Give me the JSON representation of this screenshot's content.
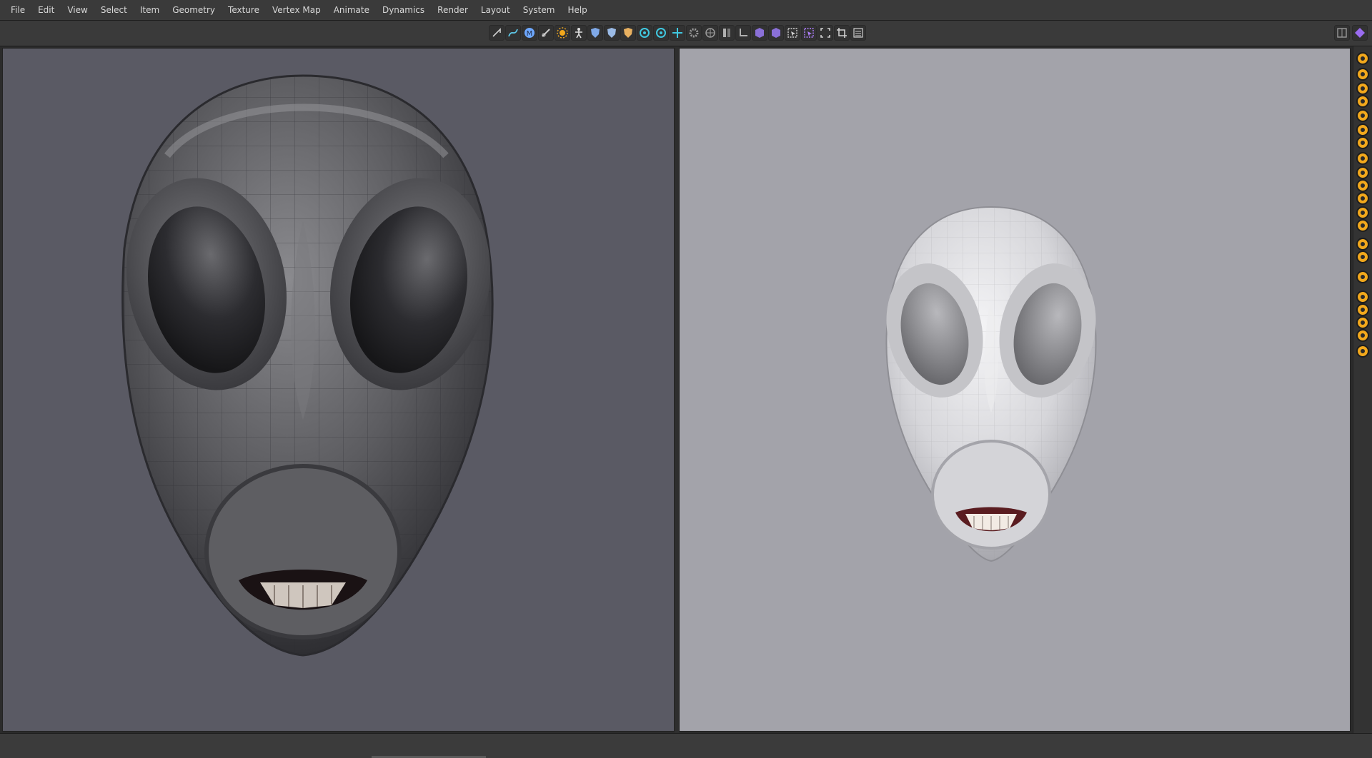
{
  "menu": [
    "File",
    "Edit",
    "View",
    "Select",
    "Item",
    "Geometry",
    "Texture",
    "Vertex Map",
    "Animate",
    "Dynamics",
    "Render",
    "Layout",
    "System",
    "Help"
  ],
  "toolbar": {
    "tools": [
      {
        "name": "pen-icon",
        "color": "#cfcfcf"
      },
      {
        "name": "curve-icon",
        "color": "#5ec8e8"
      },
      {
        "name": "m-tool-icon",
        "color": "#6ea8ff"
      },
      {
        "name": "link-icon",
        "color": "#cfcfcf"
      },
      {
        "name": "sun-icon",
        "color": "#f2a81c"
      },
      {
        "name": "figure-icon",
        "color": "#e0e0e0"
      },
      {
        "name": "shield-blue-icon",
        "color": "#7fa9e8"
      },
      {
        "name": "shield-light-icon",
        "color": "#9bbbe6"
      },
      {
        "name": "shield-orange-icon",
        "color": "#e8b060"
      },
      {
        "name": "target-icon",
        "color": "#40c8e0"
      },
      {
        "name": "ring-icon",
        "color": "#40c8e0"
      },
      {
        "name": "crosshair-icon",
        "color": "#40c8e0"
      },
      {
        "name": "gear-icon",
        "color": "#9a9a9a"
      },
      {
        "name": "grid-icon",
        "color": "#9a9a9a"
      },
      {
        "name": "split-icon",
        "color": "#b0b0b0"
      },
      {
        "name": "corner-icon",
        "color": "#b0b0b0"
      },
      {
        "name": "cube-purple-icon",
        "color": "#8a70d8"
      },
      {
        "name": "cube-dark-icon",
        "color": "#8a70d8"
      },
      {
        "name": "select-icon",
        "color": "#d0d0d0"
      },
      {
        "name": "select-purple-icon",
        "color": "#b080ff"
      },
      {
        "name": "frame-icon",
        "color": "#d0d0d0"
      },
      {
        "name": "crop-icon",
        "color": "#d0d0d0"
      },
      {
        "name": "list-icon",
        "color": "#d0d0d0"
      }
    ],
    "right": [
      {
        "name": "layout-icon",
        "color": "#9a9a9a"
      },
      {
        "name": "purple-gem-icon",
        "color": "#9a6cf0"
      }
    ]
  },
  "side_tools": [
    "rotate-icon",
    "ring-icon",
    "pin-icon",
    "lines-icon",
    "shield-icon",
    "box-icon",
    "refresh-icon",
    "heart-icon",
    "heart-dark-icon",
    "chevron-down-icon",
    "chevron-up-icon",
    "burst-icon",
    "pie-icon",
    "pause-icon",
    "smile-icon",
    "target-icon",
    "circle-icon",
    "gear-icon",
    "x-icon",
    "dot-icon",
    "flower-icon"
  ],
  "colors": {
    "left_viewport": "#5a5a64",
    "right_viewport": "#a3a3aa",
    "accent": "#f2a81c"
  }
}
